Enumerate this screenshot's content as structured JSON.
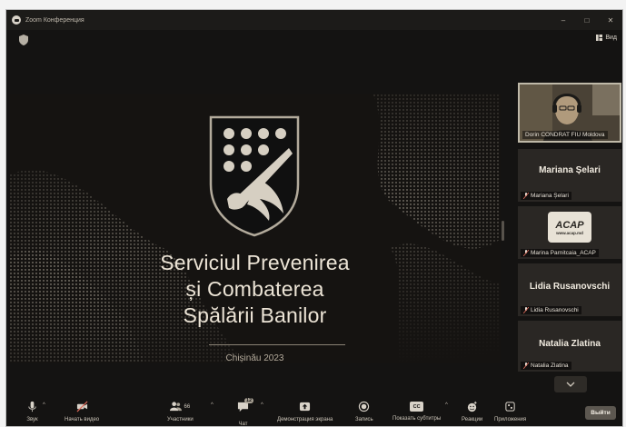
{
  "window": {
    "title": "Zoom Конференция",
    "controls": [
      "–",
      "□",
      "✕"
    ]
  },
  "topbar": {
    "view_label": "Вид"
  },
  "slide": {
    "title_lines": [
      "Serviciul Prevenirea",
      "și Combaterea",
      "Spălării Banilor"
    ],
    "date": "Chișinău 2023"
  },
  "participants": [
    {
      "name": "Dorin CONDRAT FIU Moldova",
      "type": "video"
    },
    {
      "display_name": "Mariana Șelari",
      "label": "Mariana Șelari",
      "type": "name"
    },
    {
      "label": "Marina Parnitcaia_ACAP",
      "logo_text": "ACAP",
      "logo_sub": "www.acap.md",
      "type": "logo"
    },
    {
      "display_name": "Lidia Rusanovschi",
      "label": "Lidia Rusanovschi",
      "type": "name"
    },
    {
      "display_name": "Natalia Zlatina",
      "label": "Natalia Zlatina",
      "type": "name"
    }
  ],
  "toolbar": {
    "audio": "Звук",
    "video": "Начать видео",
    "participants": "Участники",
    "participants_count": "66",
    "chat": "Чат",
    "chat_badge": "12",
    "share": "Демонстрация экрана",
    "record": "Запись",
    "captions": "Показать субтитры",
    "cc": "CC",
    "reactions": "Реакции",
    "apps": "Приложения",
    "leave": "Выйти"
  },
  "colors": {
    "accent": "#e8e0d2",
    "background": "#141312",
    "leave": "#5c5750"
  }
}
